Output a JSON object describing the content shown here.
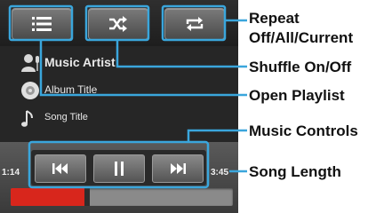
{
  "player": {
    "artist": "Music Artist",
    "album": "Album Title",
    "song": "Song Title",
    "elapsed": "1:14",
    "duration": "3:45",
    "progress_fraction": 0.33
  },
  "toolbar": {
    "playlist_icon": "list-icon",
    "shuffle_icon": "shuffle-icon",
    "repeat_icon": "repeat-icon"
  },
  "controls": {
    "prev_icon": "previous-icon",
    "pause_icon": "pause-icon",
    "next_icon": "next-icon"
  },
  "callouts": {
    "repeat_line1": "Repeat",
    "repeat_line2": "Off/All/Current",
    "shuffle": "Shuffle On/Off",
    "playlist": "Open Playlist",
    "controls": "Music Controls",
    "length": "Song Length"
  },
  "colors": {
    "callout_line": "#3aa6dc",
    "progress_fill": "#d8261c"
  }
}
